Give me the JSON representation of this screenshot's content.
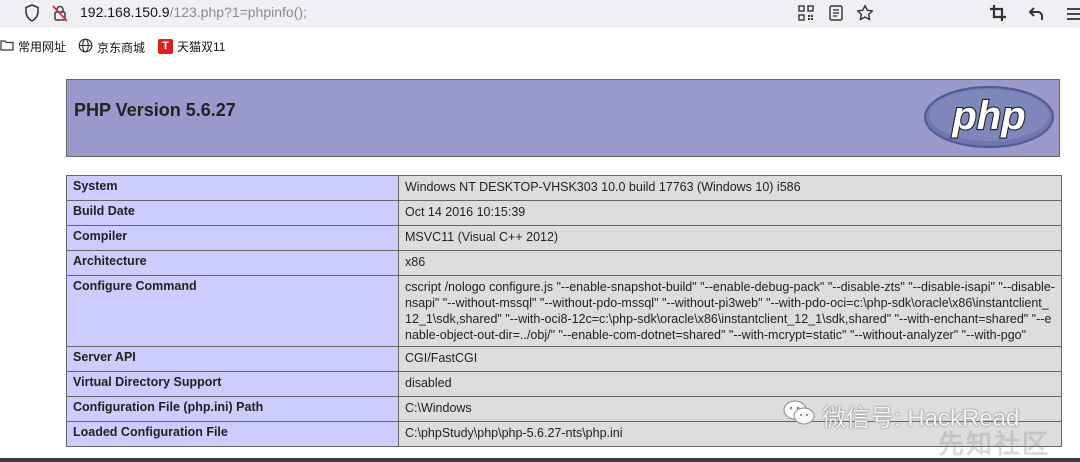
{
  "browser": {
    "url_host": "192.168.150.9",
    "url_path": "/123.php?1=phpinfo();"
  },
  "bookmarks": [
    {
      "label": "常用网址",
      "icon": "folder-icon"
    },
    {
      "label": "京东商城",
      "icon": "globe-icon"
    },
    {
      "label": "天猫双11",
      "icon": "tmall-icon",
      "icon_text": "T",
      "icon_color": "#e0201b"
    }
  ],
  "php": {
    "version_title": "PHP Version 5.6.27",
    "logo_text": "php",
    "header_color": "#9999cc",
    "rows": [
      {
        "key": "System",
        "value": "Windows NT DESKTOP-VHSK303 10.0 build 17763 (Windows 10) i586"
      },
      {
        "key": "Build Date",
        "value": "Oct 14 2016 10:15:39"
      },
      {
        "key": "Compiler",
        "value": "MSVC11 (Visual C++ 2012)"
      },
      {
        "key": "Architecture",
        "value": "x86"
      },
      {
        "key": "Configure Command",
        "value": "cscript /nologo configure.js \"--enable-snapshot-build\" \"--enable-debug-pack\" \"--disable-zts\" \"--disable-isapi\" \"--disable-nsapi\" \"--without-mssql\" \"--without-pdo-mssql\" \"--without-pi3web\" \"--with-pdo-oci=c:\\php-sdk\\oracle\\x86\\instantclient_12_1\\sdk,shared\" \"--with-oci8-12c=c:\\php-sdk\\oracle\\x86\\instantclient_12_1\\sdk,shared\" \"--with-enchant=shared\" \"--enable-object-out-dir=../obj/\" \"--enable-com-dotnet=shared\" \"--with-mcrypt=static\" \"--without-analyzer\" \"--with-pgo\""
      },
      {
        "key": "Server API",
        "value": "CGI/FastCGI"
      },
      {
        "key": "Virtual Directory Support",
        "value": "disabled"
      },
      {
        "key": "Configuration File (php.ini) Path",
        "value": "C:\\Windows"
      },
      {
        "key": "Loaded Configuration File",
        "value": "C:\\phpStudy\\php\\php-5.6.27-nts\\php.ini"
      }
    ]
  },
  "watermark": {
    "text": "微信号: HackRead",
    "text2": "先知社区"
  }
}
